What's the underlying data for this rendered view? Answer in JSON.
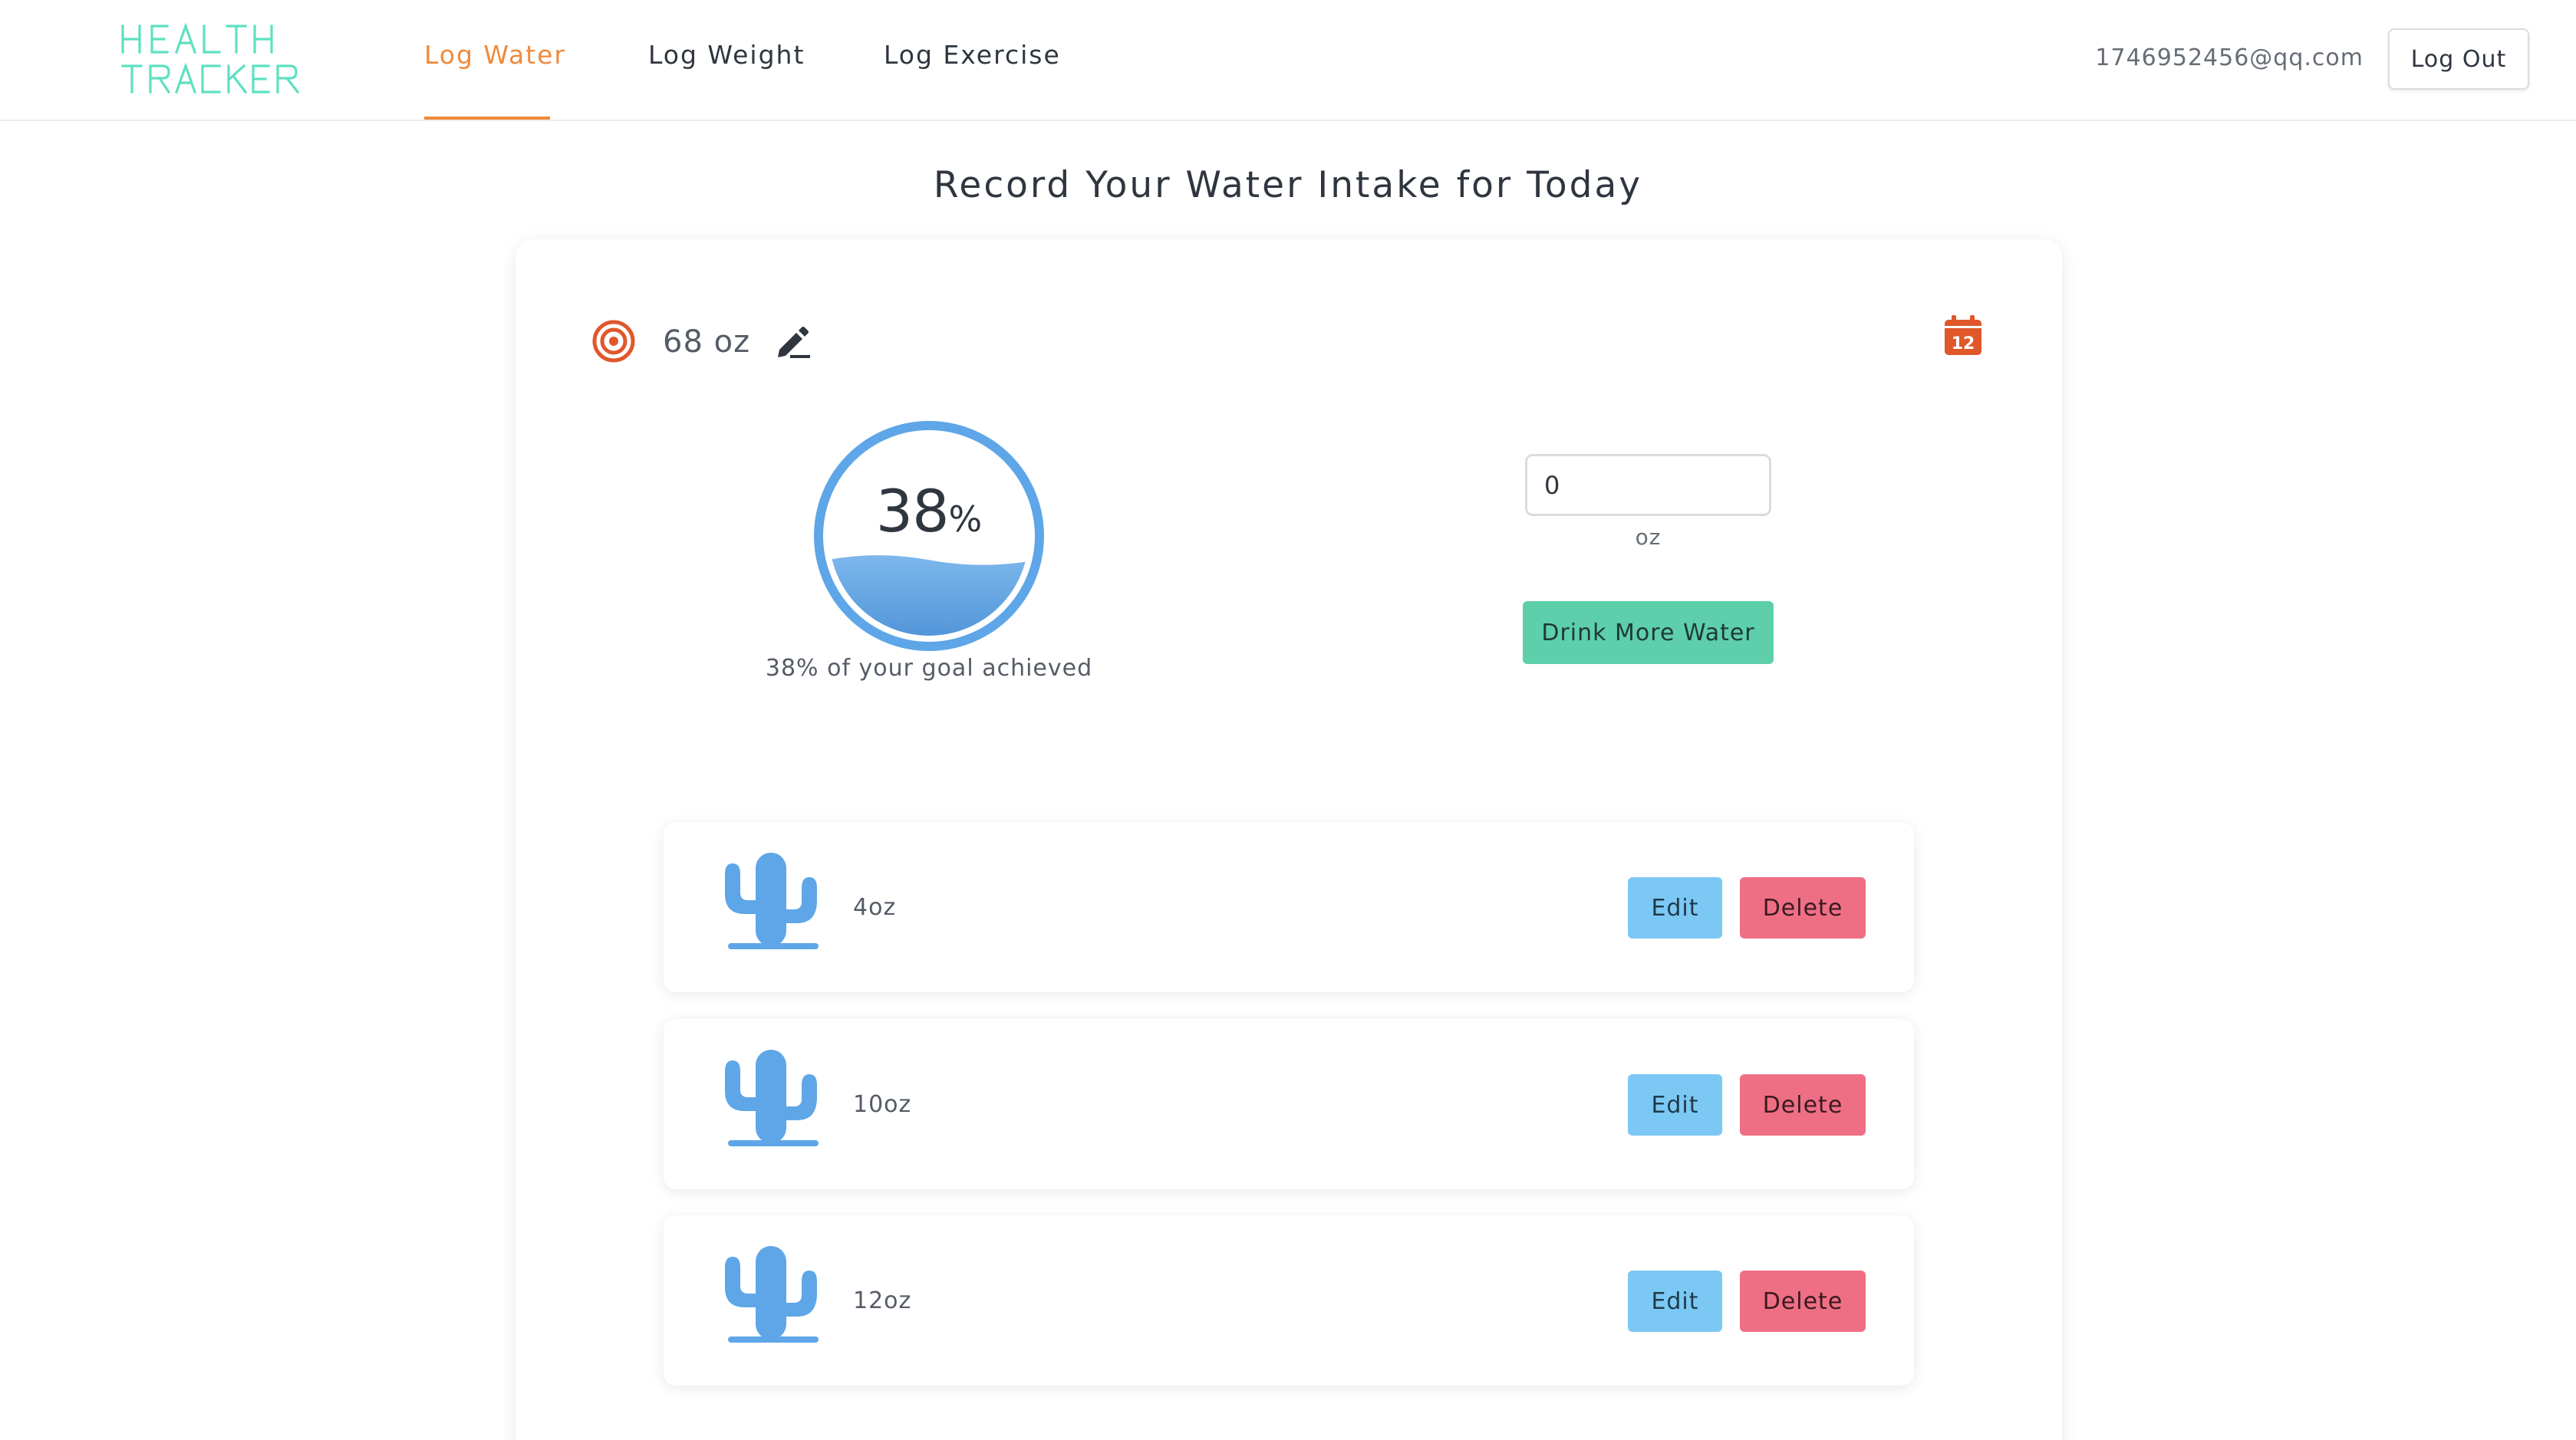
{
  "header": {
    "logo_text": "HEALTH TRACKER",
    "logo_line1": "HEALTH",
    "logo_line2": "TRACKER",
    "nav": [
      {
        "label": "Log Water",
        "active": true
      },
      {
        "label": "Log Weight",
        "active": false
      },
      {
        "label": "Log Exercise",
        "active": false
      }
    ],
    "user_email": "1746952456@qq.com",
    "logout_label": "Log Out"
  },
  "page": {
    "title": "Record Your Water Intake for Today"
  },
  "goal": {
    "icon": "target-icon",
    "value": "68 oz",
    "edit_icon": "pencil-icon",
    "calendar_icon": "calendar-icon",
    "calendar_day": "12"
  },
  "progress": {
    "percent": 38,
    "percent_number": "38",
    "percent_sign": "%",
    "caption": "38% of your goal achieved"
  },
  "intake_form": {
    "input_value": "0",
    "unit_label": "oz",
    "submit_label": "Drink More Water"
  },
  "entries": [
    {
      "icon": "cactus-icon",
      "amount": "4oz",
      "edit_label": "Edit",
      "delete_label": "Delete"
    },
    {
      "icon": "cactus-icon",
      "amount": "10oz",
      "edit_label": "Edit",
      "delete_label": "Delete"
    },
    {
      "icon": "cactus-icon",
      "amount": "12oz",
      "edit_label": "Edit",
      "delete_label": "Delete"
    }
  ],
  "colors": {
    "accent_orange": "#ee8a3c",
    "logo_teal": "#5ee0c2",
    "water_blue": "#5ea6e8",
    "drink_button": "#5dcfaa",
    "edit_button": "#7cc8f4",
    "delete_button": "#ee6f84",
    "goal_icon_red": "#e0572a"
  }
}
